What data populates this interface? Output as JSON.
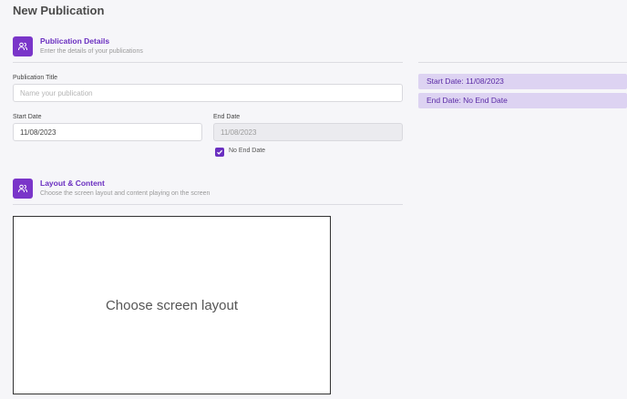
{
  "page": {
    "title": "New Publication"
  },
  "publication_details": {
    "icon": "users-icon",
    "title": "Publication Details",
    "subtitle": "Enter the details of your publications",
    "title_label": "Publication Title",
    "title_placeholder": "Name your publication",
    "title_value": "",
    "start_date_label": "Start Date",
    "start_date_value": "11/08/2023",
    "end_date_label": "End Date",
    "end_date_value": "11/08/2023",
    "no_end_date_label": "No End Date",
    "no_end_date_checked": true
  },
  "summary": {
    "start": "Start Date: 11/08/2023",
    "end": "End Date: No End Date"
  },
  "layout_content": {
    "icon": "users-icon",
    "title": "Layout & Content",
    "subtitle": "Choose the screen layout and content playing on the screen",
    "choose_layout_label": "Choose screen layout"
  },
  "colors": {
    "accent": "#7a35c9",
    "accent_text": "#6a2fc0",
    "pill_bg": "#ddd3f2",
    "background": "#f6f6f9"
  }
}
